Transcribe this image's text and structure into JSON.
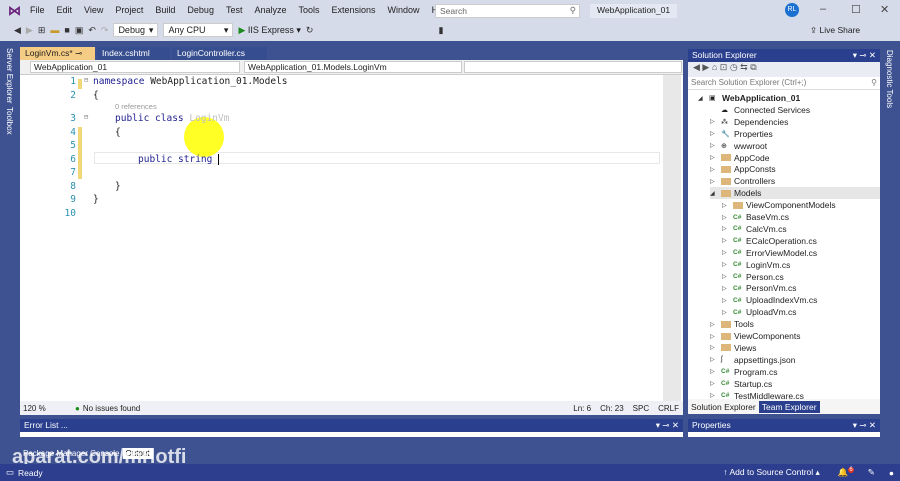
{
  "menu": [
    "File",
    "Edit",
    "View",
    "Project",
    "Build",
    "Debug",
    "Test",
    "Analyze",
    "Tools",
    "Extensions",
    "Window",
    "Help"
  ],
  "search_placeholder": "Search",
  "window_title": "WebApplication_01",
  "user_initials": "RL",
  "live_share": "Live Share",
  "toolbar": {
    "config": "Debug",
    "platform": "Any CPU",
    "run": "IIS Express"
  },
  "left_strip": [
    "Server Explorer",
    "Toolbox"
  ],
  "right_strip": "Diagnostic Tools",
  "tabs": [
    "LoginVm.cs*",
    "Index.cshtml",
    "LoginController.cs"
  ],
  "navbar": {
    "project": "WebApplication_01",
    "type": "WebApplication_01.Models.LoginVm"
  },
  "code": {
    "line_numbers": [
      "1",
      "2",
      "3",
      "4",
      "5",
      "6",
      "7",
      "8",
      "9",
      "10"
    ],
    "l1_kw": "namespace",
    "l1_rest": " WebApplication_01.Models",
    "l2": "{",
    "refs": "0 references",
    "l3_kw": "public class",
    "l3_name": " LoginVm",
    "l4": "{",
    "l6": "public string ",
    "l8": "}",
    "l9": "}"
  },
  "editor_status": {
    "zoom": "120 %",
    "issues": "No issues found",
    "ln": "Ln: 6",
    "ch": "Ch: 23",
    "spc": "SPC",
    "crlf": "CRLF"
  },
  "solution_explorer": {
    "title": "Solution Explorer",
    "search_placeholder": "Search Solution Explorer (Ctrl+;)",
    "items": [
      {
        "label": "WebApplication_01",
        "level": 0,
        "icon": "project-icon",
        "arrow": "◢"
      },
      {
        "label": "Connected Services",
        "level": 1,
        "icon": "cloud-icon",
        "arrow": ""
      },
      {
        "label": "Dependencies",
        "level": 1,
        "icon": "dependencies-icon",
        "arrow": "▷"
      },
      {
        "label": "Properties",
        "level": 1,
        "icon": "properties-icon",
        "arrow": "▷"
      },
      {
        "label": "wwwroot",
        "level": 1,
        "icon": "globe-icon",
        "arrow": "▷"
      },
      {
        "label": "AppCode",
        "level": 1,
        "icon": "folder-icon",
        "arrow": "▷"
      },
      {
        "label": "AppConsts",
        "level": 1,
        "icon": "folder-icon",
        "arrow": "▷"
      },
      {
        "label": "Controllers",
        "level": 1,
        "icon": "folder-icon",
        "arrow": "▷"
      },
      {
        "label": "Models",
        "level": 1,
        "icon": "folder-open-icon",
        "arrow": "◢"
      },
      {
        "label": "ViewComponentModels",
        "level": 2,
        "icon": "folder-icon",
        "arrow": "▷"
      },
      {
        "label": "BaseVm.cs",
        "level": 2,
        "icon": "csharp-file-icon",
        "arrow": "▷"
      },
      {
        "label": "CalcVm.cs",
        "level": 2,
        "icon": "csharp-file-icon",
        "arrow": "▷"
      },
      {
        "label": "ECalcOperation.cs",
        "level": 2,
        "icon": "csharp-file-icon",
        "arrow": "▷"
      },
      {
        "label": "ErrorViewModel.cs",
        "level": 2,
        "icon": "csharp-file-icon",
        "arrow": "▷"
      },
      {
        "label": "LoginVm.cs",
        "level": 2,
        "icon": "csharp-file-icon",
        "arrow": "▷"
      },
      {
        "label": "Person.cs",
        "level": 2,
        "icon": "csharp-file-icon",
        "arrow": "▷"
      },
      {
        "label": "PersonVm.cs",
        "level": 2,
        "icon": "csharp-file-icon",
        "arrow": "▷"
      },
      {
        "label": "UploadIndexVm.cs",
        "level": 2,
        "icon": "csharp-file-icon",
        "arrow": "▷"
      },
      {
        "label": "UploadVm.cs",
        "level": 2,
        "icon": "csharp-file-icon",
        "arrow": "▷"
      },
      {
        "label": "Tools",
        "level": 1,
        "icon": "folder-icon",
        "arrow": "▷"
      },
      {
        "label": "ViewComponents",
        "level": 1,
        "icon": "folder-icon",
        "arrow": "▷"
      },
      {
        "label": "Views",
        "level": 1,
        "icon": "folder-icon",
        "arrow": "▷"
      },
      {
        "label": "appsettings.json",
        "level": 1,
        "icon": "json-file-icon",
        "arrow": "▷"
      },
      {
        "label": "Program.cs",
        "level": 1,
        "icon": "csharp-file-icon",
        "arrow": "▷"
      },
      {
        "label": "Startup.cs",
        "level": 1,
        "icon": "csharp-file-icon",
        "arrow": "▷"
      },
      {
        "label": "TestMiddleware.cs",
        "level": 1,
        "icon": "csharp-file-icon",
        "arrow": "▷"
      }
    ],
    "tabs": [
      "Solution Explorer",
      "Team Explorer"
    ]
  },
  "error_list": "Error List ...",
  "properties": "Properties",
  "bottom_tabs": [
    "Package Manager Console",
    "Output"
  ],
  "watermark": "aparat.com/mrlotfi",
  "status": {
    "ready": "Ready",
    "source_control": "Add to Source Control",
    "notifications": "6"
  }
}
